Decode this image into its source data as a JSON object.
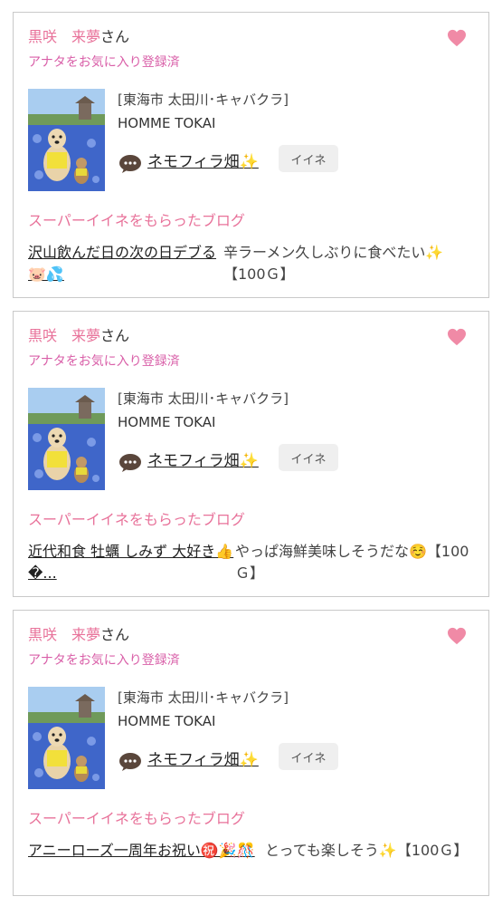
{
  "cards": [
    {
      "user_name": "黒咲　来夢",
      "user_suffix": "さん",
      "favorite_status": "アナタをお気に入り登録済",
      "shop_area": "[東海市 太田川･キャバクラ]",
      "shop_name": "HOMME TOKAI",
      "post_title": "ネモフィラ畑",
      "post_emoji": "✨",
      "iine_label": "イイネ",
      "section_label": "スーパーイイネをもらったブログ",
      "blog_title": "沢山飲んだ日の次の日デブる🐷💦",
      "blog_comment": "辛ラーメン久しぶりに食べたい✨【100Ｇ】"
    },
    {
      "user_name": "黒咲　来夢",
      "user_suffix": "さん",
      "favorite_status": "アナタをお気に入り登録済",
      "shop_area": "[東海市 太田川･キャバクラ]",
      "shop_name": "HOMME TOKAI",
      "post_title": "ネモフィラ畑",
      "post_emoji": "✨",
      "iine_label": "イイネ",
      "section_label": "スーパーイイネをもらったブログ",
      "blog_title": "近代和食 牡蠣 しみず 大好き👍�...",
      "blog_comment": "やっぱ海鮮美味しそうだな☺️【100Ｇ】"
    },
    {
      "user_name": "黒咲　来夢",
      "user_suffix": "さん",
      "favorite_status": "アナタをお気に入り登録済",
      "shop_area": "[東海市 太田川･キャバクラ]",
      "shop_name": "HOMME TOKAI",
      "post_title": "ネモフィラ畑",
      "post_emoji": "✨",
      "iine_label": "イイネ",
      "section_label": "スーパーイイネをもらったブログ",
      "blog_title": "アニーローズ一周年お祝い㊗️🎉🎊",
      "blog_comment": "とっても楽しそう✨【100Ｇ】"
    }
  ],
  "colors": {
    "accent_pink": "#e8729a",
    "status_magenta": "#d95fa8",
    "heart": "#f08aa6"
  },
  "icons": [
    "heart-icon",
    "speech-bubble-icon"
  ]
}
